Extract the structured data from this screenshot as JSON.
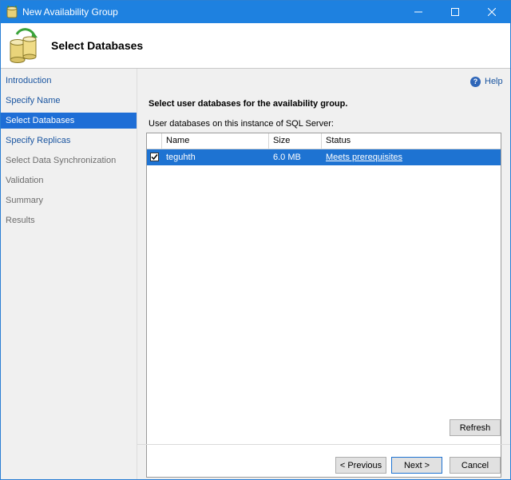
{
  "window": {
    "title": "New Availability Group"
  },
  "header": {
    "title": "Select Databases",
    "icon": "database-icon"
  },
  "sidebar": {
    "items": [
      {
        "label": "Introduction",
        "state": "link"
      },
      {
        "label": "Specify Name",
        "state": "link"
      },
      {
        "label": "Select Databases",
        "state": "selected"
      },
      {
        "label": "Specify Replicas",
        "state": "link"
      },
      {
        "label": "Select Data Synchronization",
        "state": "disabled"
      },
      {
        "label": "Validation",
        "state": "disabled"
      },
      {
        "label": "Summary",
        "state": "disabled"
      },
      {
        "label": "Results",
        "state": "disabled"
      }
    ]
  },
  "content": {
    "help_label": "Help",
    "instruction": "Select user databases for the availability group.",
    "db_label": "User databases on this instance of SQL Server:",
    "table": {
      "columns": [
        "Name",
        "Size",
        "Status"
      ],
      "rows": [
        {
          "checked": true,
          "name": "teguhth",
          "size": "6.0 MB",
          "status": "Meets prerequisites"
        }
      ]
    },
    "refresh_label": "Refresh"
  },
  "footer": {
    "prev_label": "< Previous",
    "next_label": "Next >",
    "cancel_label": "Cancel"
  },
  "colors": {
    "titlebar": "#1e81e0",
    "selection": "#1e73d2",
    "link": "#1a55a0"
  }
}
